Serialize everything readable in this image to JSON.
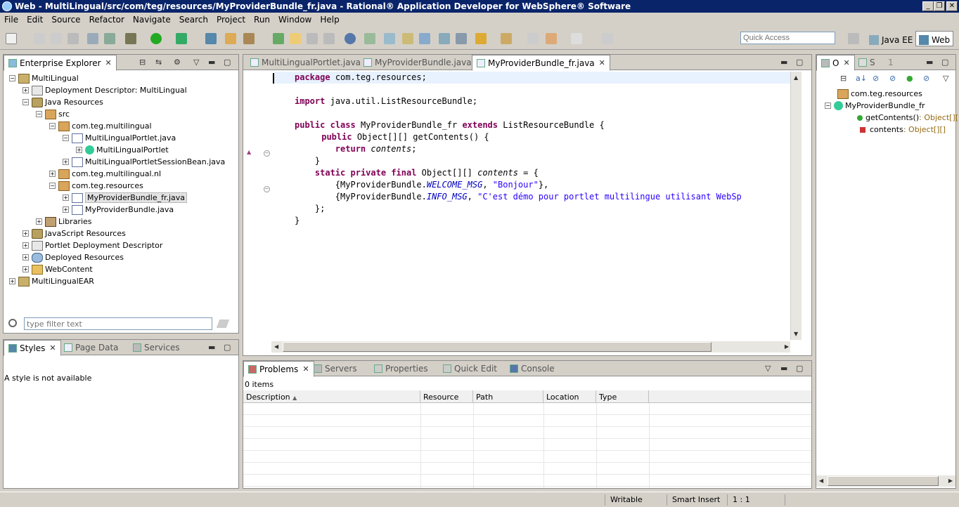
{
  "window": {
    "title": "Web - MultiLingual/src/com/teg/resources/MyProviderBundle_fr.java - Rational® Application Developer for WebSphere® Software"
  },
  "menu": [
    "File",
    "Edit",
    "Source",
    "Refactor",
    "Navigate",
    "Search",
    "Project",
    "Run",
    "Window",
    "Help"
  ],
  "toolbar": {
    "quick_access_placeholder": "Quick Access",
    "perspective_javaee": "Java EE",
    "perspective_web": "Web"
  },
  "explorer": {
    "tab_label": "Enterprise Explorer",
    "filter_placeholder": "type filter text",
    "items": [
      {
        "label": "MultiLingual",
        "level": 0,
        "exp": "-",
        "icon": "proj"
      },
      {
        "label": "Deployment Descriptor: MultiLingual",
        "level": 1,
        "exp": "+",
        "icon": "dd"
      },
      {
        "label": "Java Resources",
        "level": 1,
        "exp": "-",
        "icon": "jr"
      },
      {
        "label": "src",
        "level": 2,
        "exp": "-",
        "icon": "pkg"
      },
      {
        "label": "com.teg.multilingual",
        "level": 3,
        "exp": "-",
        "icon": "pkg"
      },
      {
        "label": "MultiLingualPortlet.java",
        "level": 4,
        "exp": "-",
        "icon": "file"
      },
      {
        "label": "MultiLingualPortlet",
        "level": 5,
        "exp": "+",
        "icon": "class"
      },
      {
        "label": "MultiLingualPortletSessionBean.java",
        "level": 4,
        "exp": "+",
        "icon": "file"
      },
      {
        "label": "com.teg.multilingual.nl",
        "level": 3,
        "exp": "+",
        "icon": "pkg"
      },
      {
        "label": "com.teg.resources",
        "level": 3,
        "exp": "-",
        "icon": "pkg"
      },
      {
        "label": "MyProviderBundle_fr.java",
        "level": 4,
        "exp": "+",
        "icon": "file",
        "selected": true
      },
      {
        "label": "MyProviderBundle.java",
        "level": 4,
        "exp": "+",
        "icon": "file"
      },
      {
        "label": "Libraries",
        "level": 2,
        "exp": "+",
        "icon": "lib"
      },
      {
        "label": "JavaScript Resources",
        "level": 1,
        "exp": "+",
        "icon": "jr"
      },
      {
        "label": "Portlet Deployment Descriptor",
        "level": 1,
        "exp": "+",
        "icon": "dd"
      },
      {
        "label": "Deployed Resources",
        "level": 1,
        "exp": "+",
        "icon": "dep"
      },
      {
        "label": "WebContent",
        "level": 1,
        "exp": "+",
        "icon": "folder"
      },
      {
        "label": "MultiLingualEAR",
        "level": 0,
        "exp": "+",
        "icon": "proj"
      }
    ]
  },
  "styles_panel": {
    "tabs": [
      "Styles",
      "Page Data",
      "Services"
    ],
    "message": "A style is not available"
  },
  "editor": {
    "tabs": [
      "MultiLingualPortlet.java",
      "MyProviderBundle.java",
      "MyProviderBundle_fr.java"
    ],
    "lines": [
      [
        [
          "kw",
          "package"
        ],
        [
          "",
          "com.teg.resources;"
        ]
      ],
      [],
      [
        [
          "kw",
          "import"
        ],
        [
          "",
          "java.util.ListResourceBundle;"
        ]
      ],
      [],
      [
        [
          "kw",
          "public"
        ],
        [
          "",
          " "
        ],
        [
          "kw",
          "class"
        ],
        [
          "",
          " MyProviderBundle_fr "
        ],
        [
          "kw",
          "extends"
        ],
        [
          "",
          " ListResourceBundle {"
        ]
      ],
      [
        [
          "",
          " "
        ],
        [
          "kw",
          "public"
        ],
        [
          "",
          " Object[][] getContents() {"
        ]
      ],
      [
        [
          "",
          "        "
        ],
        [
          "kw",
          "return"
        ],
        [
          "",
          " "
        ],
        [
          "it",
          "contents"
        ],
        [
          "",
          ";"
        ]
      ],
      [
        [
          "",
          "    }"
        ]
      ],
      [
        [
          "",
          "    "
        ],
        [
          "kw",
          "static"
        ],
        [
          "",
          " "
        ],
        [
          "kw",
          "private"
        ],
        [
          "",
          " "
        ],
        [
          "kw",
          "final"
        ],
        [
          "",
          " Object[][] "
        ],
        [
          "it",
          "contents"
        ],
        [
          "",
          " = {"
        ]
      ],
      [
        [
          "",
          "        {MyProviderBundle."
        ],
        [
          "sf",
          "WELCOME_MSG"
        ],
        [
          "",
          ", "
        ],
        [
          "st",
          "\"Bonjour\""
        ],
        [
          "",
          "},"
        ]
      ],
      [
        [
          "",
          "        {MyProviderBundle."
        ],
        [
          "sf",
          "INFO_MSG"
        ],
        [
          "",
          ", "
        ],
        [
          "st",
          "\"C'est démo pour portlet multilingue utilisant WebSp"
        ]
      ],
      [
        [
          "",
          "    };"
        ]
      ],
      [
        [
          "",
          "}"
        ]
      ]
    ]
  },
  "problems": {
    "tabs": [
      "Problems",
      "Servers",
      "Properties",
      "Quick Edit",
      "Console"
    ],
    "count": "0 items",
    "columns": [
      "Description",
      "Resource",
      "Path",
      "Location",
      "Type"
    ]
  },
  "outline": {
    "tabs": [
      "O",
      "S",
      "1"
    ],
    "items": [
      {
        "label": "com.teg.resources",
        "type": ""
      },
      {
        "label": "MyProviderBundle_fr",
        "type": ""
      },
      {
        "label": "getContents()",
        "type": " : Object[][]"
      },
      {
        "label": "contents",
        "type": " : Object[][]"
      }
    ]
  },
  "status": {
    "writable": "Writable",
    "insert_mode": "Smart Insert",
    "position": "1 : 1"
  }
}
